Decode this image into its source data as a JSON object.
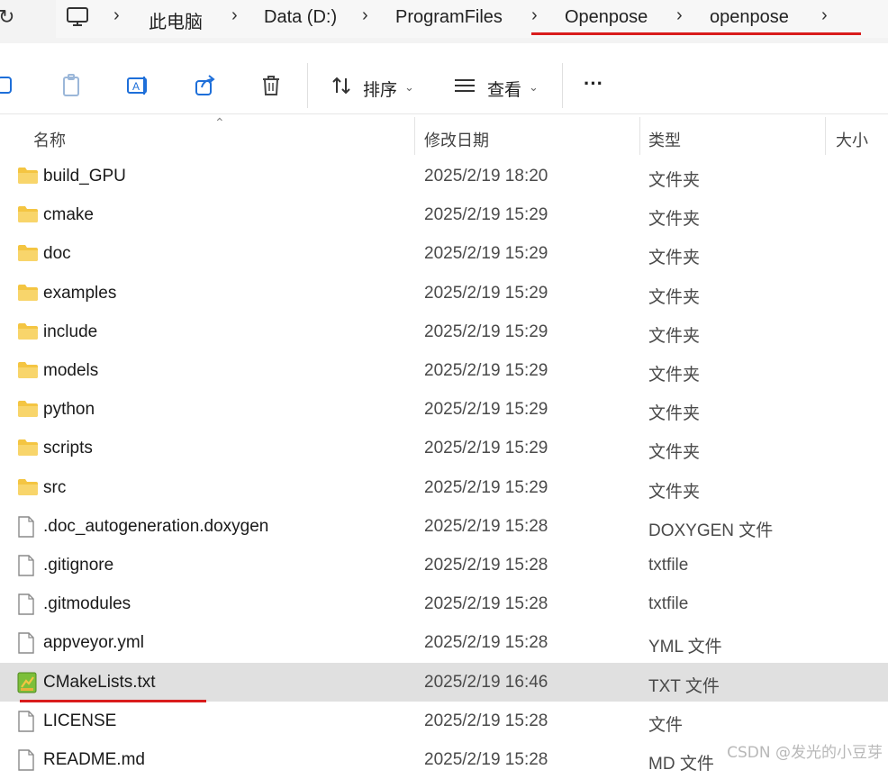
{
  "address": {
    "crumbs": [
      "此电脑",
      "Data (D:)",
      "ProgramFiles",
      "Openpose",
      "openpose"
    ]
  },
  "toolbar": {
    "sort_label": "排序",
    "view_label": "查看",
    "more_label": "···"
  },
  "columns": {
    "name": "名称",
    "date": "修改日期",
    "type": "类型",
    "size": "大小"
  },
  "files": [
    {
      "name": "build_GPU",
      "date": "2025/2/19 18:20",
      "type": "文件夹",
      "kind": "folder"
    },
    {
      "name": "cmake",
      "date": "2025/2/19 15:29",
      "type": "文件夹",
      "kind": "folder"
    },
    {
      "name": "doc",
      "date": "2025/2/19 15:29",
      "type": "文件夹",
      "kind": "folder"
    },
    {
      "name": "examples",
      "date": "2025/2/19 15:29",
      "type": "文件夹",
      "kind": "folder"
    },
    {
      "name": "include",
      "date": "2025/2/19 15:29",
      "type": "文件夹",
      "kind": "folder"
    },
    {
      "name": "models",
      "date": "2025/2/19 15:29",
      "type": "文件夹",
      "kind": "folder"
    },
    {
      "name": "python",
      "date": "2025/2/19 15:29",
      "type": "文件夹",
      "kind": "folder"
    },
    {
      "name": "scripts",
      "date": "2025/2/19 15:29",
      "type": "文件夹",
      "kind": "folder"
    },
    {
      "name": "src",
      "date": "2025/2/19 15:29",
      "type": "文件夹",
      "kind": "folder"
    },
    {
      "name": ".doc_autogeneration.doxygen",
      "date": "2025/2/19 15:28",
      "type": "DOXYGEN 文件",
      "kind": "file"
    },
    {
      "name": ".gitignore",
      "date": "2025/2/19 15:28",
      "type": "txtfile",
      "kind": "file"
    },
    {
      "name": ".gitmodules",
      "date": "2025/2/19 15:28",
      "type": "txtfile",
      "kind": "file"
    },
    {
      "name": "appveyor.yml",
      "date": "2025/2/19 15:28",
      "type": "YML 文件",
      "kind": "file"
    },
    {
      "name": "CMakeLists.txt",
      "date": "2025/2/19 16:46",
      "type": "TXT 文件",
      "kind": "txt",
      "selected": true
    },
    {
      "name": "LICENSE",
      "date": "2025/2/19 15:28",
      "type": "文件",
      "kind": "file"
    },
    {
      "name": "README.md",
      "date": "2025/2/19 15:28",
      "type": "MD 文件",
      "kind": "file"
    }
  ],
  "watermark": "CSDN @发光的小豆芽",
  "colors": {
    "folder": "#f4c542",
    "annotation_red": "#d91c1c",
    "selected_row": "#e0e0e0"
  }
}
